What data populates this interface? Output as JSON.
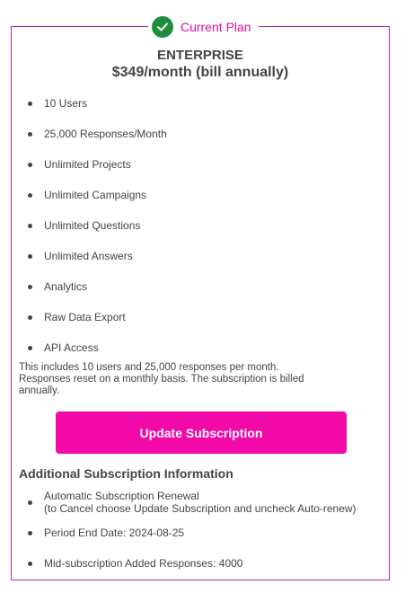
{
  "badge": {
    "label": "Current Plan",
    "icon": "check-circle-icon",
    "icon_color": "#1e8e3e",
    "label_color": "#e00da5"
  },
  "plan": {
    "name": "ENTERPRISE",
    "price": "$349/month (bill annually)"
  },
  "features": [
    "10 Users",
    "25,000 Responses/Month",
    "Unlimited Projects",
    "Unlimited Campaigns",
    "Unlimited Questions",
    "Unlimited Answers",
    "Analytics",
    "Raw Data Export",
    "API Access"
  ],
  "description": "This includes 10 users and 25,000 responses per month. Responses reset on a monthly basis. The subscription is billed annually.",
  "update_button": {
    "label": "Update Subscription",
    "color": "#f20aa8"
  },
  "additional": {
    "heading": "Additional Subscription Information",
    "renewal_line1": "Automatic Subscription Renewal",
    "renewal_line2": "(to Cancel choose Update Subscription and uncheck Auto-renew)",
    "period_end": "Period End Date: 2024-08-25",
    "added_responses": "Mid-subscription Added Responses: 4000"
  },
  "colors": {
    "border": "#b02ab0",
    "text": "#444444"
  }
}
